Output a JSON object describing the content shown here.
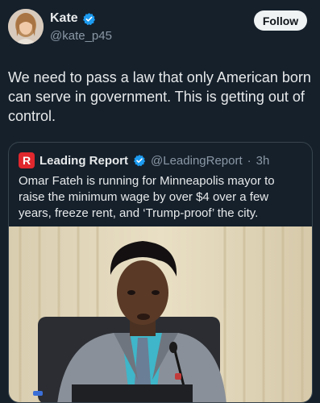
{
  "author": {
    "display_name": "Kate",
    "handle": "@kate_p45",
    "avatar_icon": "avatar-photo",
    "verified_color": "#1d9bf0"
  },
  "follow_label": "Follow",
  "tweet": {
    "text": "We need to pass a law that only American born can serve in government. This is getting out of control."
  },
  "quote": {
    "logo_letter": "R",
    "name": "Leading Report",
    "handle": "@LeadingReport",
    "separator": "·",
    "time": "3h",
    "text": "Omar Fateh is running for Minneapolis mayor to raise the minimum wage by over $4 over a few years, freeze rent, and ‘Trump-proof’ the city.",
    "media": {
      "description_icon": "video-still-man-at-microphone"
    }
  }
}
